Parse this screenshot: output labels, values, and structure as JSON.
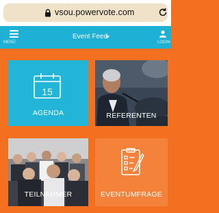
{
  "browser": {
    "url": "vsou.powervote.com"
  },
  "appbar": {
    "menu_label": "MENÜ",
    "feed_label": "Event Feed",
    "user_label": "LOGIN"
  },
  "tiles": [
    {
      "label": "AGENDA",
      "calendar_number": "15",
      "icon": "calendar-icon",
      "color": "#21b6d7"
    },
    {
      "label": "REFERENTEN",
      "icon": "speaker-photo"
    },
    {
      "label": "TEILNEHMER",
      "icon": "audience-photo"
    },
    {
      "label": "EVENTUMFRAGE",
      "icon": "survey-icon",
      "color": "#f4823a"
    }
  ],
  "colors": {
    "appbar": "#1fb1d5",
    "background": "#f37021",
    "urlbar": "#f0e2c9"
  }
}
